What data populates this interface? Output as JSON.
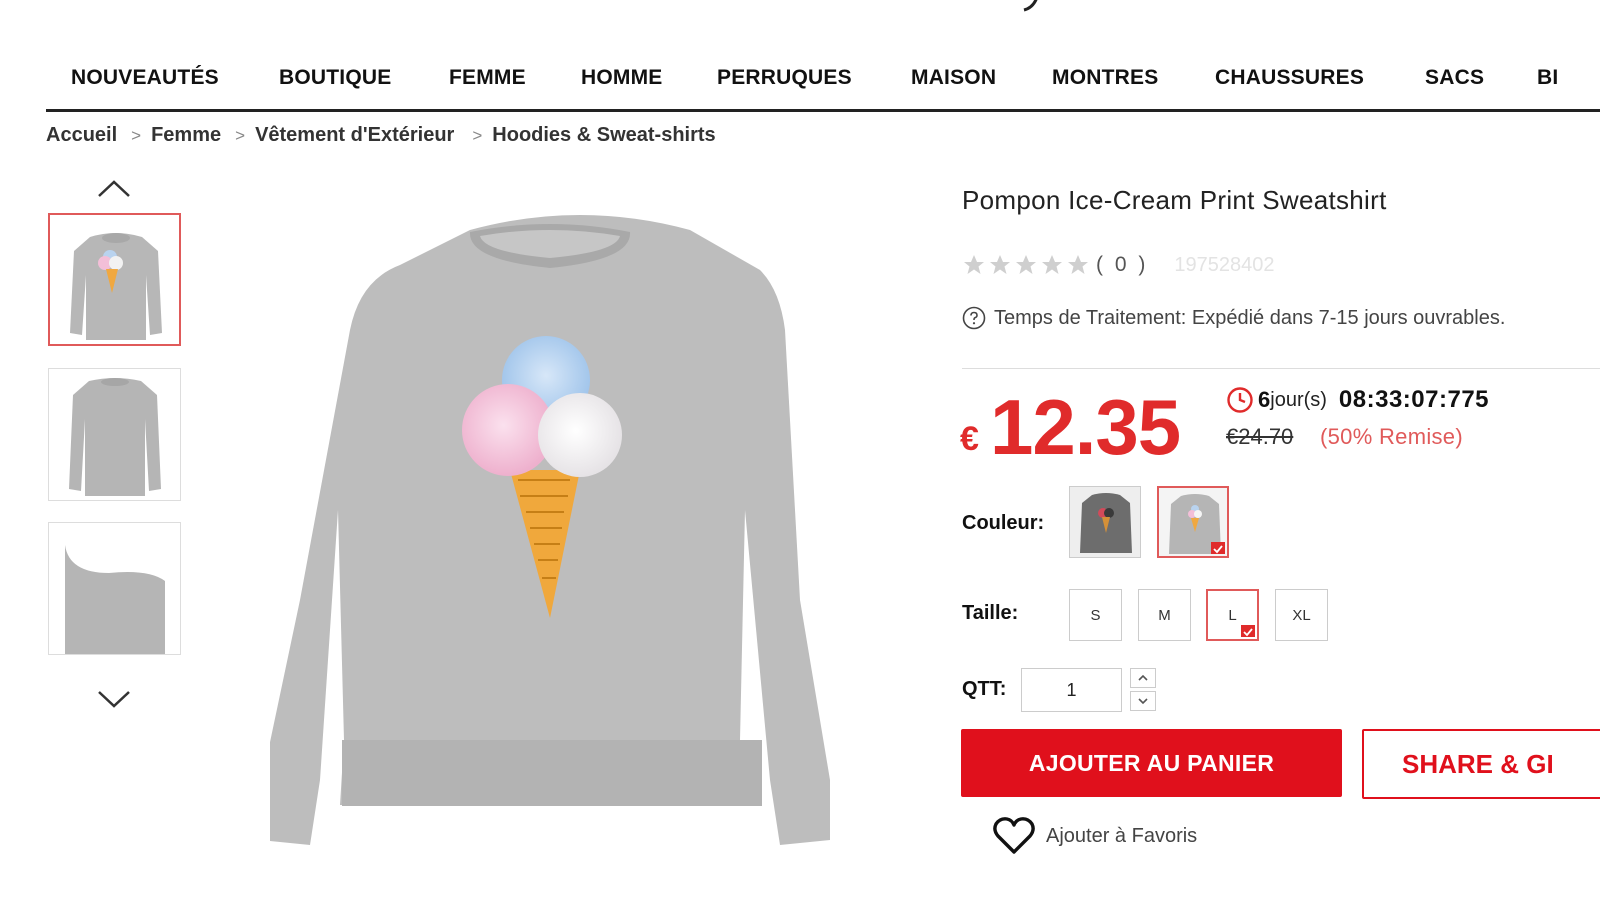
{
  "nav": {
    "items": [
      "NOUVEAUTÉS",
      "BOUTIQUE",
      "FEMME",
      "HOMME",
      "PERRUQUES",
      "MAISON",
      "MONTRES",
      "CHAUSSURES",
      "SACS",
      "BI"
    ]
  },
  "breadcrumb": {
    "items": [
      "Accueil",
      "Femme",
      "Vêtement d'Extérieur",
      "Hoodies & Sweat-shirts"
    ],
    "separator": ">"
  },
  "gallery": {
    "thumbnails": [
      "front",
      "back",
      "sleeve-detail"
    ],
    "active_index": 0
  },
  "product": {
    "title": "Pompon Ice-Cream Print Sweatshirt",
    "rating_count": "( 0 )",
    "rating_stars": 0,
    "sku": "197528402",
    "processing_label": "Temps de Traitement:",
    "processing_value": "Expédié dans 7-15 jours ouvrables."
  },
  "pricing": {
    "currency": "€",
    "price": "12.35",
    "countdown_days": "6",
    "countdown_days_label": "jour(s)",
    "countdown_time": "08:33:07:775",
    "old_price": "€24.70",
    "discount": "(50% Remise)"
  },
  "options": {
    "color_label": "Couleur:",
    "colors": [
      "dark-gray",
      "light-gray"
    ],
    "selected_color_index": 1,
    "size_label": "Taille:",
    "sizes": [
      "S",
      "M",
      "L",
      "XL"
    ],
    "selected_size": "L",
    "qty_label": "QTT:",
    "qty_value": "1"
  },
  "actions": {
    "add_to_cart": "AJOUTER AU PANIER",
    "share": "SHARE & GI",
    "add_to_favorites": "Ajouter à Favoris"
  },
  "colors": {
    "accent": "#e0101c",
    "price": "#e02b2b",
    "selected_border": "#e05a5a"
  }
}
